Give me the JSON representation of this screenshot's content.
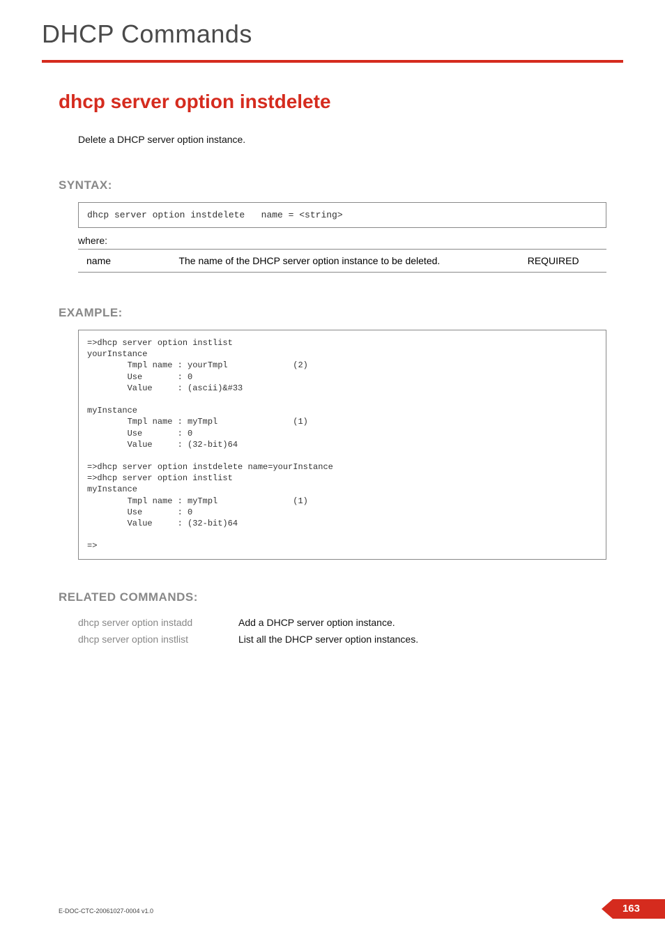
{
  "header": {
    "category": "DHCP Commands"
  },
  "command": {
    "title": "dhcp server option instdelete",
    "intro": "Delete a DHCP server option instance."
  },
  "syntax": {
    "heading": "SYNTAX:",
    "line": "dhcp server option instdelete   name = <string>",
    "where": "where:",
    "params": [
      {
        "name": "name",
        "desc": "The name of the DHCP server option instance to be deleted.",
        "req": "REQUIRED"
      }
    ]
  },
  "example": {
    "heading": "EXAMPLE:",
    "body": "=>dhcp server option instlist\nyourInstance\n        Tmpl name : yourTmpl             (2)\n        Use       : 0\n        Value     : (ascii)&#33\n\nmyInstance\n        Tmpl name : myTmpl               (1)\n        Use       : 0\n        Value     : (32-bit)64\n\n=>dhcp server option instdelete name=yourInstance\n=>dhcp server option instlist\nmyInstance\n        Tmpl name : myTmpl               (1)\n        Use       : 0\n        Value     : (32-bit)64\n\n=>"
  },
  "related": {
    "heading": "RELATED COMMANDS:",
    "rows": [
      {
        "name": "dhcp server option instadd",
        "desc": "Add a DHCP server option instance."
      },
      {
        "name": "dhcp server option instlist",
        "desc": "List all the DHCP server option instances."
      }
    ]
  },
  "footer": {
    "docid": "E-DOC-CTC-20061027-0004 v1.0",
    "page": "163"
  }
}
